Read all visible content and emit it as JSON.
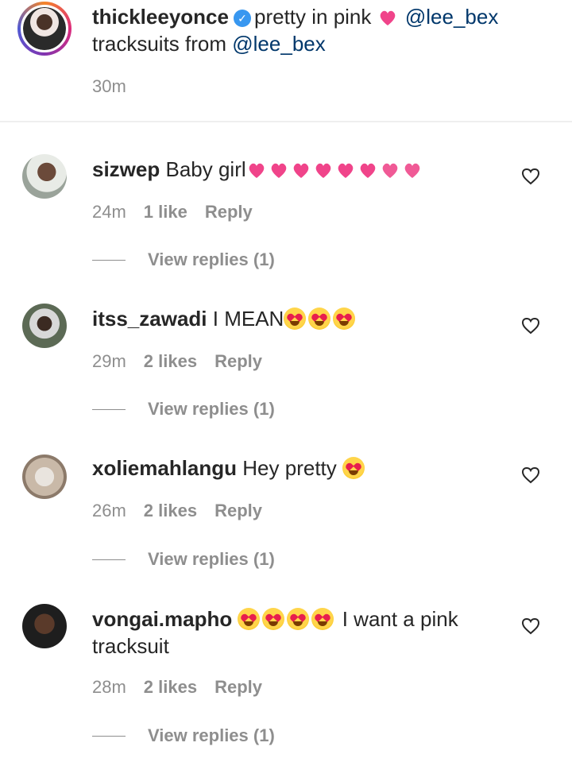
{
  "caption": {
    "username": "thickleeyonce",
    "text_part1": "pretty in pink",
    "mention1": "@lee_bex",
    "text_part2": "tracksuits from",
    "mention2": "@lee_bex",
    "time": "30m"
  },
  "comments": [
    {
      "username": "sizwep",
      "text": "Baby girl",
      "time": "24m",
      "likes": "1 like",
      "reply": "Reply",
      "view_replies": "View replies (1)"
    },
    {
      "username": "itss_zawadi",
      "text": "I MEAN",
      "time": "29m",
      "likes": "2 likes",
      "reply": "Reply",
      "view_replies": "View replies (1)"
    },
    {
      "username": "xoliemahlangu",
      "text": "Hey pretty",
      "time": "26m",
      "likes": "2 likes",
      "reply": "Reply",
      "view_replies": "View replies (1)"
    },
    {
      "username": "vongai.mapho",
      "text": "I want a pink tracksuit",
      "time": "28m",
      "likes": "2 likes",
      "reply": "Reply",
      "view_replies": "View replies (1)"
    }
  ],
  "icons": {
    "verified": "verified-badge-icon",
    "like": "heart-outline-icon"
  },
  "colors": {
    "mention": "#00376b",
    "meta": "#8e8e8e",
    "verified": "#3897f0"
  }
}
